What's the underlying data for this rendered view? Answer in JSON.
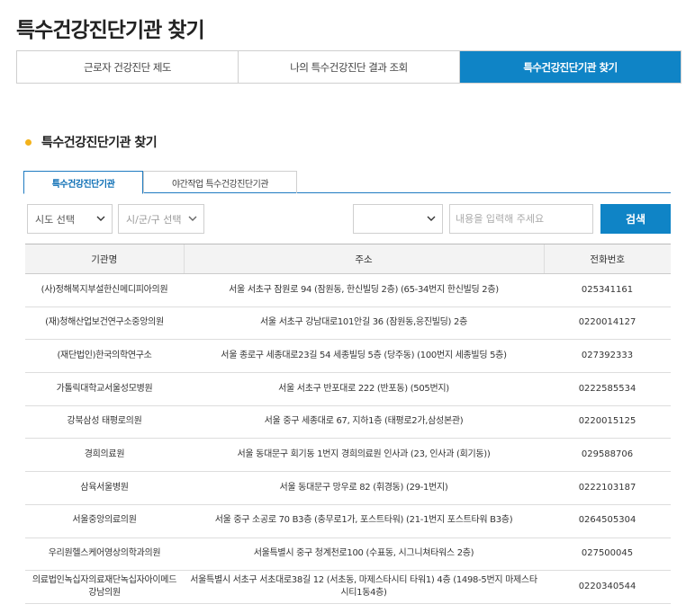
{
  "page": {
    "title": "특수건강진단기관 찾기"
  },
  "main_tabs": [
    {
      "label": "근로자 건강진단 제도"
    },
    {
      "label": "나의 특수건강진단 결과 조회"
    },
    {
      "label": "특수건강진단기관 찾기"
    }
  ],
  "section": {
    "title": "특수건강진단기관 찾기"
  },
  "sub_tabs": [
    {
      "label": "특수건강진단기관"
    },
    {
      "label": "야간작업 특수건강진단기관"
    }
  ],
  "search": {
    "sido_label": "시도 선택",
    "sigungu_label": "시/군/구 선택",
    "type_label": "",
    "placeholder": "내용을 입력해 주세요",
    "button_label": "검색"
  },
  "table": {
    "headers": [
      "기관명",
      "주소",
      "전화번호"
    ],
    "rows": [
      {
        "name": "(사)정해복지부설한신메디피아의원",
        "address": "서울 서초구 잠원로 94 (잠원동, 한신빌딩 2층) (65-34번지 한신빌딩 2층)",
        "phone": "025341161"
      },
      {
        "name": "(재)청해산업보건연구소중앙의원",
        "address": "서울 서초구 강남대로101안길 36 (잠원동,응진빌딩) 2층",
        "phone": "0220014127"
      },
      {
        "name": "(재단법인)한국의학연구소",
        "address": "서울 종로구 세종대로23길 54 세종빌딩 5층 (당주동) (100번지 세종빌딩 5층)",
        "phone": "027392333"
      },
      {
        "name": "가톨릭대학교서울성모병원",
        "address": "서울 서초구 반포대로 222 (반포동) (505번지)",
        "phone": "0222585534"
      },
      {
        "name": "강북삼성 태평로의원",
        "address": "서울 중구 세종대로 67, 지하1층 (태평로2가,삼성본관)",
        "phone": "0220015125"
      },
      {
        "name": "경희의료원",
        "address": "서울 동대문구 회기동 1번지 경희의료원 인사과 (23, 인사과 (회기동))",
        "phone": "029588706"
      },
      {
        "name": "삼육서울병원",
        "address": "서울 동대문구 망우로 82 (휘경동) (29-1번지)",
        "phone": "0222103187"
      },
      {
        "name": "서울중앙의료의원",
        "address": "서울 중구 소공로 70 B3층 (충무로1가, 포스트타워) (21-1번지 포스트타워 B3층)",
        "phone": "0264505304"
      },
      {
        "name": "우리원헬스케어영상의학과의원",
        "address": "서울특별시 중구 청계천로100 (수표동, 시그니쳐타워스 2층)",
        "phone": "027500045"
      },
      {
        "name": "의료법인녹십자의료재단녹십자아이메드강남의원",
        "address": "서울특별시 서초구 서초대로38길 12 (서초동, 마제스타시티 타워1) 4층 (1498-5번지 마제스타시티1동4층)",
        "phone": "0220340544"
      }
    ]
  },
  "colors": {
    "accent": "#0f84c6",
    "bullet": "#f3b21b"
  }
}
